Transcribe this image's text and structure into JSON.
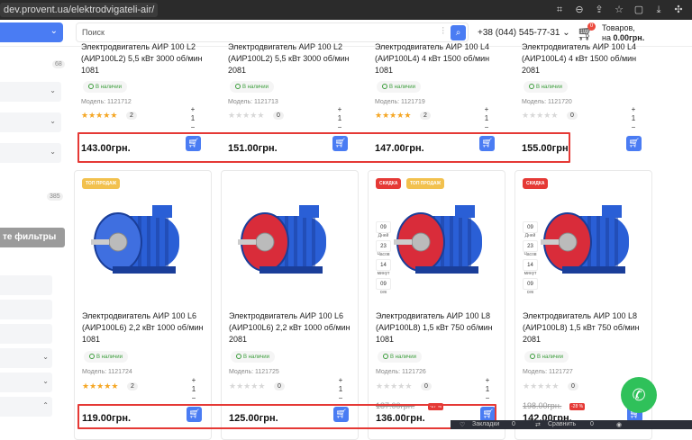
{
  "browser": {
    "url": "dev.provent.ua/elektrodvigateli-air/"
  },
  "header": {
    "search_placeholder": "Поиск",
    "phone": "+38 (044) 545-77-31",
    "cart_count": "0",
    "cart_line1": "Товаров,",
    "cart_line2_prefix": "на",
    "cart_total": "0.00грн."
  },
  "sidebar": {
    "count_1": "68",
    "count_2": "385",
    "reset_label": "те фильтры"
  },
  "products_row1": [
    {
      "title_l1": "Электродвигатель АИР 100 L2",
      "title_l2": "(АИР100L2) 5,5 кВт 3000 об/мин",
      "title_l3": "1081",
      "stock": "В наличии",
      "model": "Модель: 1121712",
      "rating": 5,
      "reviews": "2",
      "price": "143.00грн."
    },
    {
      "title_l1": "Электродвигатель АИР 100 L2",
      "title_l2": "(АИР100L2) 5,5 кВт 3000 об/мин",
      "title_l3": "2081",
      "stock": "В наличии",
      "model": "Модель: 1121713",
      "rating": 0,
      "reviews": "0",
      "price": "151.00грн."
    },
    {
      "title_l1": "Электродвигатель АИР 100 L4",
      "title_l2": "(АИР100L4) 4 кВт 1500 об/мин",
      "title_l3": "1081",
      "stock": "В наличии",
      "model": "Модель: 1121719",
      "rating": 5,
      "reviews": "2",
      "price": "147.00грн."
    },
    {
      "title_l1": "Электродвигатель АИР 100 L4",
      "title_l2": "(АИР100L4) 4 кВт 1500 об/мин",
      "title_l3": "2081",
      "stock": "В наличии",
      "model": "Модель: 1121720",
      "rating": 0,
      "reviews": "0",
      "price": "155.00грн."
    }
  ],
  "products_row2": [
    {
      "badge": "ТОП ПРОДАЖ",
      "title_l1": "Электродвигатель АИР 100 L6",
      "title_l2": "(АИР100L6) 2,2 кВт 1000 об/мин",
      "title_l3": "1081",
      "stock": "В наличии",
      "model": "Модель: 1121724",
      "rating": 5,
      "reviews": "2",
      "price": "119.00грн."
    },
    {
      "title_l1": "Электродвигатель АИР 100 L6",
      "title_l2": "(АИР100L6) 2,2 кВт 1000 об/мин",
      "title_l3": "2081",
      "stock": "В наличии",
      "model": "Модель: 1121725",
      "rating": 0,
      "reviews": "0",
      "price": "125.00грн."
    },
    {
      "badge_sale": "СКИДКА",
      "badge": "ТОП ПРОДАЖ",
      "title_l1": "Электродвигатель АИР 100 L8",
      "title_l2": "(АИР100L8) 1,5 кВт 750 об/мин",
      "title_l3": "1081",
      "stock": "В наличии",
      "model": "Модель: 1121726",
      "rating": 0,
      "reviews": "0",
      "old_price": "187.00грн.",
      "discount": "-27 %",
      "price": "136.00грн."
    },
    {
      "badge_sale": "СКИДКА",
      "title_l1": "Электродвигатель АИР 100 L8",
      "title_l2": "(АИР100L8) 1,5 кВт 750 об/мин",
      "title_l3": "2081",
      "stock": "В наличии",
      "model": "Модель: 1121727",
      "rating": 0,
      "reviews": "0",
      "old_price": "198.00грн.",
      "discount": "-28 %",
      "price": "142.00грн."
    }
  ],
  "timers": [
    {
      "days": "09",
      "days_label": "Дней",
      "hours": "23",
      "hours_label": "Часов",
      "mins": "14",
      "mins_label": "минут",
      "secs": "09",
      "secs_label": "сек"
    },
    {
      "days": "09",
      "days_label": "Дней",
      "hours": "23",
      "hours_label": "Часов",
      "mins": "14",
      "mins_label": "минут",
      "secs": "09",
      "secs_label": "сек"
    }
  ],
  "qty": {
    "plus": "+",
    "value": "1",
    "minus": "−"
  },
  "bottombar": {
    "item1": "Закладки",
    "count1": "0",
    "item2": "Сравнить",
    "count2": "0"
  },
  "colors": {
    "accent": "#4a7cf3",
    "highlight": "#e53935",
    "whatsapp": "#2fc15a"
  }
}
